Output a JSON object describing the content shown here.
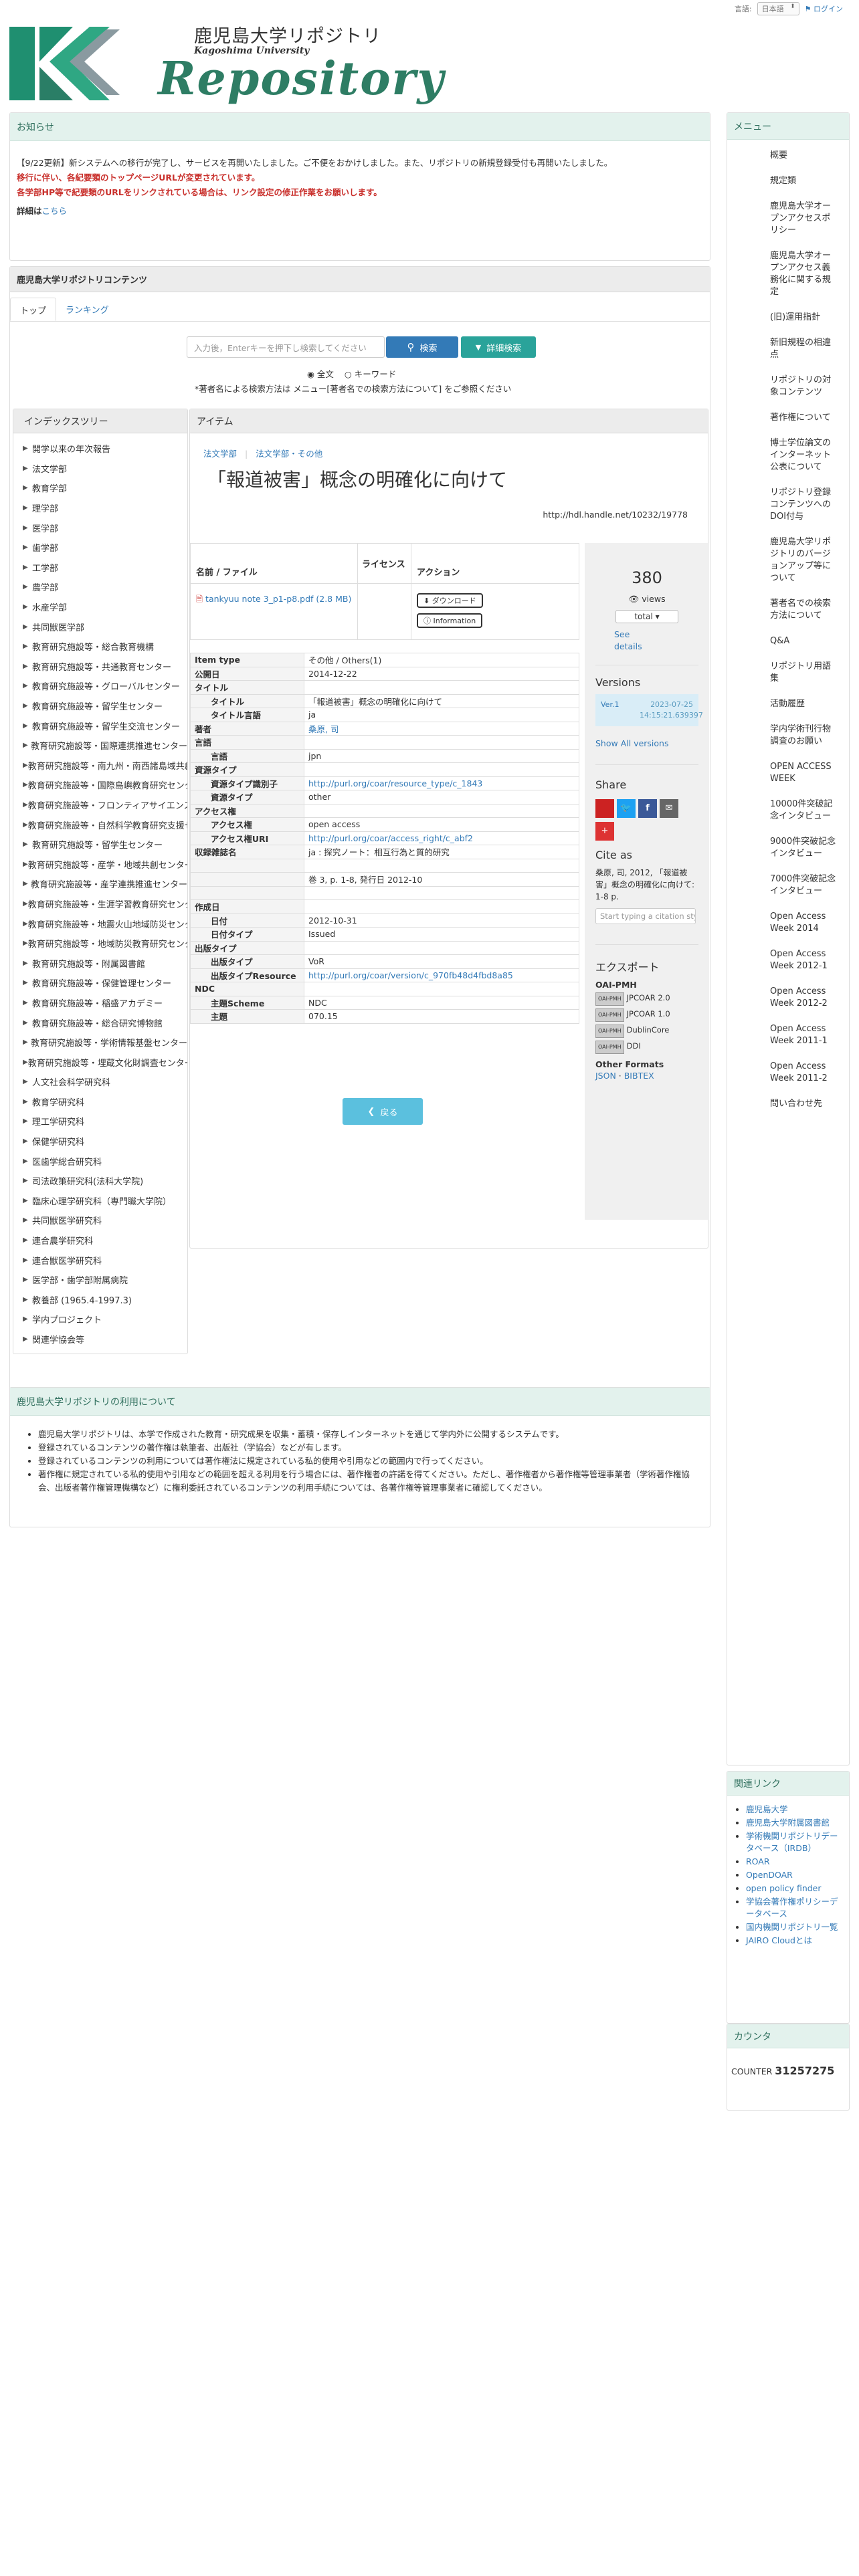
{
  "topbar": {
    "lang_label": "言語:",
    "lang_value": "日本語",
    "login": "ログイン"
  },
  "logo": {
    "title_jp": "鹿児島大学リポジトリ",
    "subtitle": "Kagoshima University",
    "word": "Repository"
  },
  "notice": {
    "heading": "お知らせ",
    "line1": "【9/22更新】新システムへの移行が完了し、サービスを再開いたしました。ご不便をおかけしました。また、リポジトリの新規登録受付も再開いたしました。",
    "line2": "移行に伴い、各紀要類のトップページURLが変更されています。",
    "line3": "各学部HP等で紀要類のURLをリンクされている場合は、リンク設定の修正作業をお願いします。",
    "detail_label": "詳細は",
    "detail_link": "こちら"
  },
  "contents": {
    "heading": "鹿児島大学リポジトリコンテンツ",
    "tabs": [
      "トップ",
      "ランキング"
    ],
    "search_placeholder": "入力後，Enterキーを押下し検索してください",
    "search_button": "検索",
    "advanced_button": "詳細検索",
    "radio_full": "全文",
    "radio_keyword": "キーワード",
    "hint": "*著者名による検索方法は メニュー[著者名での検索方法について] をご参照ください"
  },
  "index_tree": {
    "heading": "インデックスツリー",
    "items": [
      "開学以来の年次報告",
      "法文学部",
      "教育学部",
      "理学部",
      "医学部",
      "歯学部",
      "工学部",
      "農学部",
      "水産学部",
      "共同獣医学部",
      "教育研究施設等・総合教育機構",
      "教育研究施設等・共通教育センター",
      "教育研究施設等・グローバルセンター",
      "教育研究施設等・留学生センター",
      "教育研究施設等・留学生交流センター",
      "教育研究施設等・国際連携推進センター",
      "教育研究施設等・南九州・南西諸島域共創機構",
      "教育研究施設等・国際島嶼教育研究センター",
      "教育研究施設等・フロンティアサイエンス研究推進センター",
      "教育研究施設等・自然科学教育研究支援センター",
      "教育研究施設等・留学生センター",
      "教育研究施設等・産学・地域共創センター",
      "教育研究施設等・産学連携推進センター",
      "教育研究施設等・生涯学習教育研究センター",
      "教育研究施設等・地震火山地域防災センター",
      "教育研究施設等・地域防災教育研究センター",
      "教育研究施設等・附属図書館",
      "教育研究施設等・保健管理センター",
      "教育研究施設等・稲盛アカデミー",
      "教育研究施設等・総合研究博物館",
      "教育研究施設等・学術情報基盤センター",
      "教育研究施設等・埋蔵文化財調査センター",
      "人文社会科学研究科",
      "教育学研究科",
      "理工学研究科",
      "保健学研究科",
      "医歯学総合研究科",
      "司法政策研究科(法科大学院)",
      "臨床心理学研究科（専門職大学院）",
      "共同獣医学研究科",
      "連合農学研究科",
      "連合獣医学研究科",
      "医学部・歯学部附属病院",
      "教養部 (1965.4-1997.3)",
      "学内プロジェクト",
      "関連学協会等"
    ]
  },
  "item": {
    "heading": "アイテム",
    "breadcrumb": [
      "法文学部",
      "法文学部・その他"
    ],
    "title": "「報道被害」概念の明確化に向けて",
    "handle": "http://hdl.handle.net/10232/19778",
    "file_headers": [
      "名前 / ファイル",
      "ライセンス",
      "アクション"
    ],
    "file_name": "tankyuu note 3_p1-p8.pdf (2.8 MB)",
    "download_btn": "ダウンロード",
    "info_btn": "Information",
    "views_count": "380",
    "views_label": "views",
    "views_select": "total",
    "see_details": "See details",
    "versions_heading": "Versions",
    "version_label": "Ver.1",
    "version_date": "2023-07-25 14:15:21.639397",
    "show_all": "Show All versions",
    "share_heading": "Share",
    "cite_heading": "Cite as",
    "cite_text": "桑原, 司, 2012, 「報道被害」概念の明確化に向けて: 1-8 p.",
    "cite_placeholder": "Start typing a citation style...",
    "export_heading": "エクスポート",
    "oai_heading": "OAI-PMH",
    "exports": [
      "JPCOAR 2.0",
      "JPCOAR 1.0",
      "DublinCore",
      "DDI"
    ],
    "badge_label": "OAI-PMH",
    "other_heading": "Other Formats",
    "json": "JSON",
    "bibtex": "BIBTEX",
    "back": "戻る",
    "metadata": [
      {
        "k": "Item type",
        "v": "その他 / Others(1)",
        "sub": false,
        "link": false
      },
      {
        "k": "公開日",
        "v": "2014-12-22",
        "sub": false,
        "link": false
      },
      {
        "k": "タイトル",
        "v": "",
        "sub": false,
        "link": false
      },
      {
        "k": "タイトル",
        "v": "「報道被害」概念の明確化に向けて",
        "sub": true,
        "link": false
      },
      {
        "k": "タイトル言語",
        "v": "ja",
        "sub": true,
        "link": false
      },
      {
        "k": "著者",
        "v": "桑原, 司",
        "sub": false,
        "link": true
      },
      {
        "k": "言語",
        "v": "",
        "sub": false,
        "link": false
      },
      {
        "k": "言語",
        "v": "jpn",
        "sub": true,
        "link": false
      },
      {
        "k": "資源タイプ",
        "v": "",
        "sub": false,
        "link": false
      },
      {
        "k": "資源タイプ識別子",
        "v": "http://purl.org/coar/resource_type/c_1843",
        "sub": true,
        "link": true
      },
      {
        "k": "資源タイプ",
        "v": "other",
        "sub": true,
        "link": false
      },
      {
        "k": "アクセス権",
        "v": "",
        "sub": false,
        "link": false
      },
      {
        "k": "アクセス権",
        "v": "open access",
        "sub": true,
        "link": false
      },
      {
        "k": "アクセス権URI",
        "v": "http://purl.org/coar/access_right/c_abf2",
        "sub": true,
        "link": true
      },
      {
        "k": "収録雑誌名",
        "v": "ja : 探究ノート：相互行為と質的研究",
        "sub": false,
        "link": false
      },
      {
        "k": "",
        "v": "",
        "sub": false,
        "link": false
      },
      {
        "k": "",
        "v": "巻 3, p. 1-8, 発行日 2012-10",
        "sub": false,
        "link": false
      },
      {
        "k": "",
        "v": "",
        "sub": false,
        "link": false
      },
      {
        "k": "作成日",
        "v": "",
        "sub": false,
        "link": false
      },
      {
        "k": "日付",
        "v": "2012-10-31",
        "sub": true,
        "link": false
      },
      {
        "k": "日付タイプ",
        "v": "Issued",
        "sub": true,
        "link": false
      },
      {
        "k": "出版タイプ",
        "v": "",
        "sub": false,
        "link": false
      },
      {
        "k": "出版タイプ",
        "v": "VoR",
        "sub": true,
        "link": false
      },
      {
        "k": "出版タイプResource",
        "v": "http://purl.org/coar/version/c_970fb48d4fbd8a85",
        "sub": true,
        "link": true
      },
      {
        "k": "NDC",
        "v": "",
        "sub": false,
        "link": false
      },
      {
        "k": "主題Scheme",
        "v": "NDC",
        "sub": true,
        "link": false
      },
      {
        "k": "主題",
        "v": "070.15",
        "sub": true,
        "link": false
      }
    ]
  },
  "usage": {
    "heading": "鹿児島大学リポジトリの利用について",
    "items": [
      "鹿児島大学リポジトリは、本学で作成された教育・研究成果を収集・蓄積・保存しインターネットを通じて学内外に公開するシステムです。",
      "登録されているコンテンツの著作権は執筆者、出版社（学協会）などが有します。",
      "登録されているコンテンツの利用については著作権法に規定されている私的使用や引用などの範囲内で行ってください。",
      "著作権に規定されている私的使用や引用などの範囲を超える利用を行う場合には、著作権者の許諾を得てください。ただし、著作権者から著作権等管理事業者（学術著作権協会、出版者著作権管理機構など）に権利委託されているコンテンツの利用手続については、各著作権等管理事業者に確認してください。"
    ]
  },
  "menu": {
    "heading": "メニュー",
    "items": [
      "概要",
      "規定類",
      "鹿児島大学オープンアクセスポリシー",
      "鹿児島大学オープンアクセス義務化に関する規定",
      "(旧)運用指針",
      "新旧規程の相違点",
      "リポジトリの対象コンテンツ",
      "著作権について",
      "博士学位論文のインターネット公表について",
      "リポジトリ登録コンテンツへのDOI付与",
      "鹿児島大学リポジトリのバージョンアップ等について",
      "著者名での検索方法について",
      "Q&A",
      "リポジトリ用語集",
      "活動履歴",
      "学内学術刊行物調査のお願い",
      "OPEN ACCESS WEEK",
      "10000件突破記念インタビュー",
      "9000件突破記念インタビュー",
      "7000件突破記念インタビュー",
      "Open Access Week 2014",
      "Open Access Week 2012-1",
      "Open Access Week 2012-2",
      "Open Access Week 2011-1",
      "Open Access Week 2011-2",
      "問い合わせ先"
    ]
  },
  "links": {
    "heading": "関連リンク",
    "items": [
      "鹿児島大学",
      "鹿児島大学附属図書館",
      "学術機関リポジトリデータベース（IRDB）",
      "ROAR",
      "OpenDOAR",
      "open policy finder",
      "学協会著作権ポリシーデータベース",
      "国内機関リポジトリ一覧",
      "JAIRO Cloudとは"
    ]
  },
  "counter": {
    "heading": "カウンタ",
    "label": "COUNTER",
    "value": "31257275"
  },
  "colors": {
    "accent": "#5bc0de",
    "brand_green": "#2e7d64",
    "header_bg": "#e3f2ed",
    "link": "#337ab7",
    "search_btn": "#337ab7",
    "advanced_btn": "#2aa39a"
  }
}
